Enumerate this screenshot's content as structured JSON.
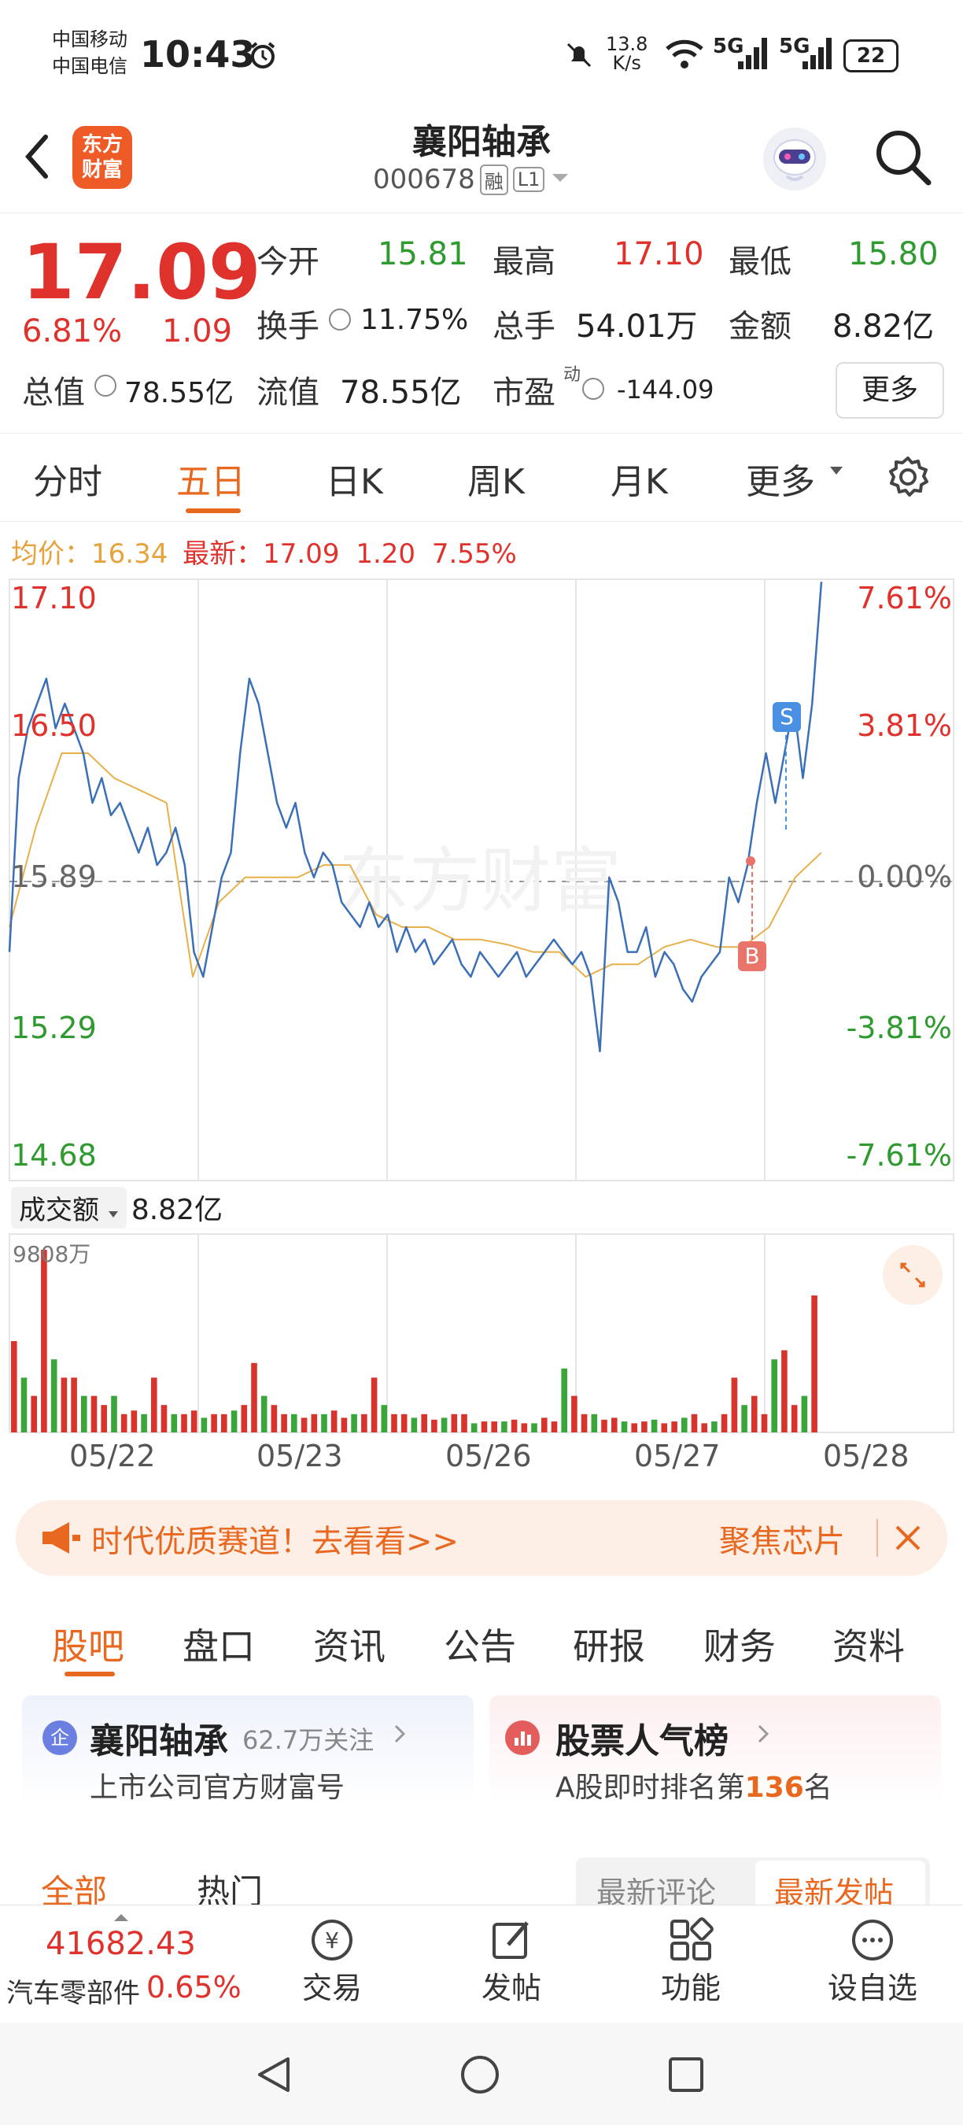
{
  "status_bar": {
    "carrier1": "中国移动",
    "carrier2": "中国电信",
    "time": "10:43",
    "speed_value": "13.8",
    "speed_unit": "K/s",
    "net1": "5G",
    "net2": "5G",
    "battery": "22"
  },
  "header": {
    "logo_line1": "东方",
    "logo_line2": "财富",
    "title": "襄阳轴承",
    "code": "000678",
    "tag1": "融",
    "tag2": "L1"
  },
  "quote": {
    "price": "17.09",
    "change_pct": "6.81%",
    "change": "1.09",
    "open_label": "今开",
    "open": "15.81",
    "high_label": "最高",
    "high": "17.10",
    "low_label": "最低",
    "low": "15.80",
    "turnover_label": "换手",
    "turnover": "11.75%",
    "volume_label": "总手",
    "volume": "54.01万",
    "amount_label": "金额",
    "amount": "8.82亿",
    "mktcap_label": "总值",
    "mktcap": "78.55亿",
    "float_label": "流值",
    "float": "78.55亿",
    "pe_label": "市盈",
    "pe_sup": "动",
    "pe": "-144.09",
    "more": "更多"
  },
  "chart_tabs": [
    "分时",
    "五日",
    "日K",
    "周K",
    "月K",
    "更多"
  ],
  "chart_info": {
    "avg_label": "均价：",
    "avg": "16.34",
    "last_label": "最新：",
    "last": "17.09",
    "chg": "1.20",
    "pct": "7.55%"
  },
  "chart_data": {
    "type": "line",
    "y_left_ticks": [
      "17.10",
      "16.50",
      "15.89",
      "15.29",
      "14.68"
    ],
    "y_right_ticks": [
      "7.61%",
      "3.81%",
      "0.00%",
      "-3.81%",
      "-7.61%"
    ],
    "ylim": [
      14.68,
      17.1
    ],
    "x_labels": [
      "05/22",
      "05/23",
      "05/26",
      "05/27",
      "05/28"
    ],
    "markers": [
      "S",
      "B"
    ],
    "series": [
      {
        "values": [
          15.6,
          16.3,
          16.5,
          16.6,
          16.7,
          16.5,
          16.6,
          16.5,
          16.4,
          16.2,
          16.3,
          16.15,
          16.2,
          16.1,
          16.0,
          16.1,
          15.95,
          16.0,
          16.1,
          15.95,
          15.6,
          15.5,
          15.7,
          15.9,
          16.0,
          16.4,
          16.7,
          16.6,
          16.4,
          16.2,
          16.1,
          16.2,
          16.0,
          15.9,
          16.0,
          15.95,
          15.8,
          15.75,
          15.7,
          15.8,
          15.7,
          15.75,
          15.6,
          15.7,
          15.6,
          15.65,
          15.55,
          15.6,
          15.65,
          15.55,
          15.5,
          15.6,
          15.55,
          15.5,
          15.55,
          15.6,
          15.5,
          15.55,
          15.6,
          15.65,
          15.6,
          15.55,
          15.6,
          15.5,
          15.2,
          15.9,
          15.8,
          15.6,
          15.6,
          15.7,
          15.5,
          15.6,
          15.55,
          15.45,
          15.4,
          15.5,
          15.55,
          15.6,
          15.9,
          15.8,
          15.95,
          16.2,
          16.4,
          16.2,
          16.4,
          16.6,
          16.3,
          16.6,
          17.09
        ]
      },
      {
        "values": [
          15.7,
          16.1,
          16.4,
          16.4,
          16.3,
          16.25,
          16.2,
          15.5,
          15.8,
          15.9,
          15.9,
          15.9,
          15.95,
          15.95,
          15.75,
          15.7,
          15.7,
          15.65,
          15.65,
          15.63,
          15.6,
          15.6,
          15.5,
          15.55,
          15.55,
          15.62,
          15.65,
          15.62,
          15.62,
          15.7,
          15.9,
          16.0
        ]
      }
    ]
  },
  "volume": {
    "dropdown_label": "成交额",
    "value": "8.82亿",
    "max_label": "9808万",
    "bars": [
      0.5,
      0.3,
      0.2,
      1.0,
      0.4,
      0.3,
      0.3,
      0.2,
      0.2,
      0.15,
      0.2,
      0.1,
      0.12,
      0.1,
      0.3,
      0.15,
      0.1,
      0.1,
      0.12,
      0.08,
      0.1,
      0.1,
      0.12,
      0.15,
      0.38,
      0.2,
      0.15,
      0.1,
      0.1,
      0.08,
      0.1,
      0.1,
      0.12,
      0.08,
      0.1,
      0.1,
      0.3,
      0.15,
      0.1,
      0.1,
      0.08,
      0.1,
      0.07,
      0.08,
      0.1,
      0.1,
      0.05,
      0.06,
      0.06,
      0.06,
      0.07,
      0.05,
      0.05,
      0.08,
      0.06,
      0.35,
      0.2,
      0.1,
      0.1,
      0.07,
      0.08,
      0.06,
      0.05,
      0.06,
      0.07,
      0.05,
      0.06,
      0.08,
      0.1,
      0.05,
      0.06,
      0.1,
      0.3,
      0.15,
      0.2,
      0.1,
      0.4,
      0.45,
      0.15,
      0.2,
      0.75
    ]
  },
  "x_axis_dates": [
    "05/22",
    "05/23",
    "05/26",
    "05/27",
    "05/28"
  ],
  "banner": {
    "text": "时代优质赛道！去看看>>",
    "right": "聚焦芯片"
  },
  "bottom_tabs": [
    "股吧",
    "盘口",
    "资讯",
    "公告",
    "研报",
    "财务",
    "资料"
  ],
  "cards": {
    "left_title": "襄阳轴承",
    "left_follow": "62.7万关注",
    "left_sub": "上市公司官方财富号",
    "right_title": "股票人气榜",
    "right_sub_prefix": "A股即时排名第",
    "right_rank": "136",
    "right_sub_suffix": "名"
  },
  "feed_tabs": {
    "all": "全部",
    "hot": "热门",
    "latest_comment": "最新评论",
    "latest_post": "最新发帖"
  },
  "bottom_nav": {
    "index_value": "41682.43",
    "sector": "汽车零部件",
    "sector_pct": "0.65%",
    "trade": "交易",
    "post": "发帖",
    "func": "功能",
    "watch": "设自选"
  }
}
